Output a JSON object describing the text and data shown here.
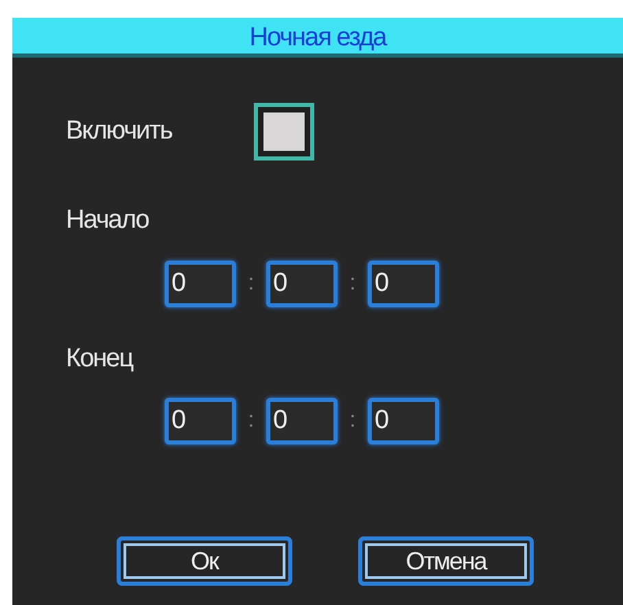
{
  "dialog": {
    "title": "Ночная езда"
  },
  "enable": {
    "label": "Включить",
    "checked": false
  },
  "times": [
    {
      "label": "Начало",
      "fields": [
        {
          "value": "0"
        },
        {
          "value": "0"
        },
        {
          "value": "0"
        }
      ],
      "separators": [
        ":",
        ":"
      ]
    },
    {
      "label": "Конец",
      "fields": [
        {
          "value": "0"
        },
        {
          "value": "0"
        },
        {
          "value": "0"
        }
      ],
      "separators": [
        ":",
        ":"
      ]
    }
  ],
  "buttons": [
    {
      "label": "Ок"
    },
    {
      "label": "Отмена"
    }
  ]
}
